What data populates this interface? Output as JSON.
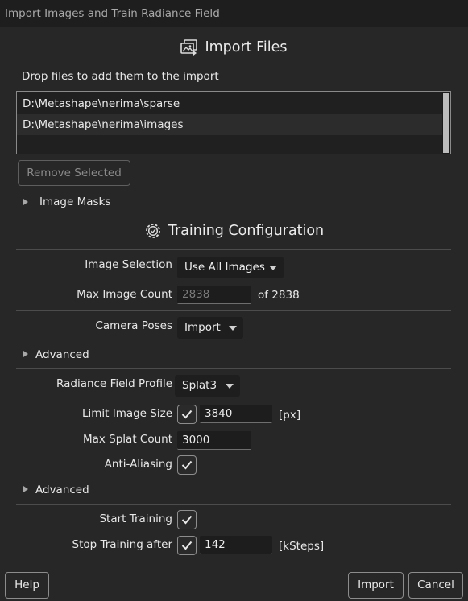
{
  "window": {
    "title": "Import Images and Train Radiance Field"
  },
  "import_files": {
    "heading": "Import Files",
    "drop_hint": "Drop files to add them to the import",
    "files": [
      "D:\\Metashape\\nerima\\sparse",
      "D:\\Metashape\\nerima\\images"
    ],
    "remove_selected_label": "Remove Selected",
    "image_masks_label": "Image Masks"
  },
  "training_config": {
    "heading": "Training Configuration",
    "image_selection": {
      "label": "Image Selection",
      "value": "Use All Images"
    },
    "max_image_count": {
      "label": "Max Image Count",
      "value": "2838",
      "suffix": "of 2838"
    },
    "camera_poses": {
      "label": "Camera Poses",
      "value": "Import"
    },
    "advanced_1_label": "Advanced",
    "radiance_field_profile": {
      "label": "Radiance Field Profile",
      "value": "Splat3"
    },
    "limit_image_size": {
      "label": "Limit Image Size",
      "checked": true,
      "value": "3840",
      "unit": "[px]"
    },
    "max_splat_count": {
      "label": "Max Splat Count",
      "value": "3000"
    },
    "anti_aliasing": {
      "label": "Anti-Aliasing",
      "checked": true
    },
    "advanced_2_label": "Advanced",
    "start_training": {
      "label": "Start Training",
      "checked": true
    },
    "stop_training_after": {
      "label": "Stop Training after",
      "checked": true,
      "value": "142",
      "unit": "[kSteps]"
    }
  },
  "footer": {
    "help_label": "Help",
    "import_label": "Import",
    "cancel_label": "Cancel"
  }
}
